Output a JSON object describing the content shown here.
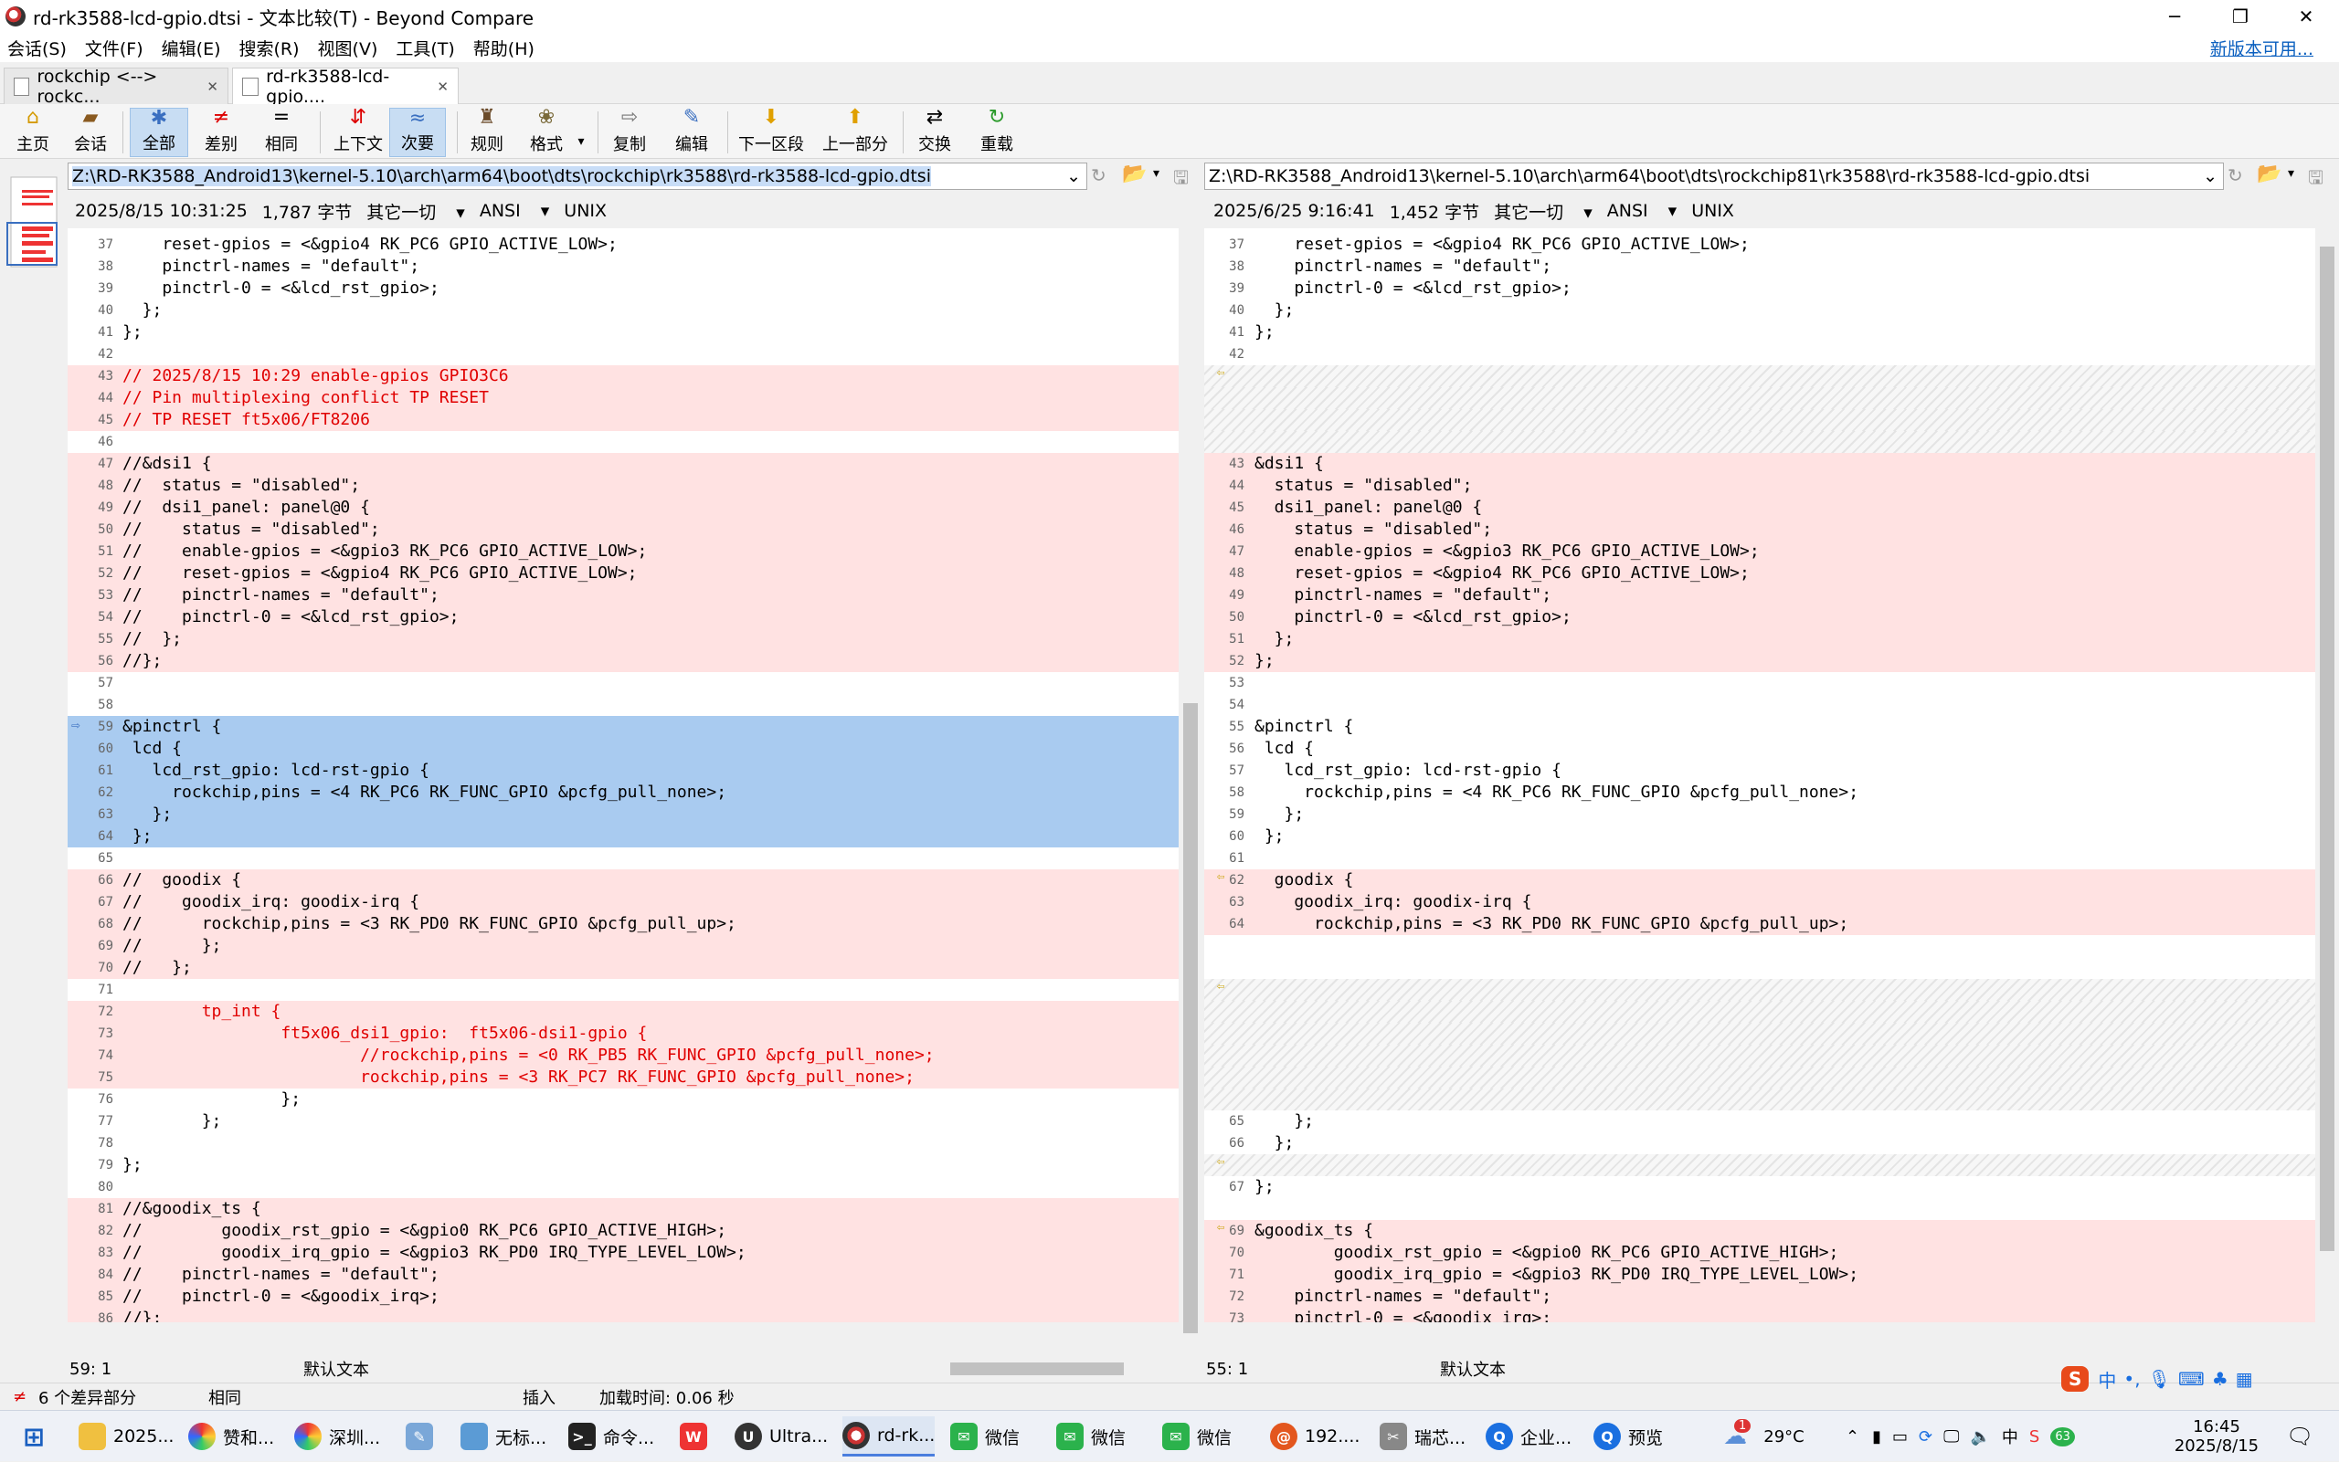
{
  "window": {
    "title": "rd-rk3588-lcd-gpio.dtsi - 文本比较(T) - Beyond Compare"
  },
  "menu": [
    "会话(S)",
    "文件(F)",
    "编辑(E)",
    "搜索(R)",
    "视图(V)",
    "工具(T)",
    "帮助(H)"
  ],
  "menu_newversion": "新版本可用...",
  "tabs": [
    {
      "label": "rockchip <--> rockc..."
    },
    {
      "label": "rd-rk3588-lcd-gpio...."
    }
  ],
  "toolbar": [
    "主页",
    "会话",
    "全部",
    "差别",
    "相同",
    "上下文",
    "次要",
    "规则",
    "格式",
    "复制",
    "编辑",
    "下一区段",
    "上一部分",
    "交换",
    "重载"
  ],
  "left": {
    "path": "Z:\\RD-RK3588_Android13\\kernel-5.10\\arch\\arm64\\boot\\dts\\rockchip\\rk3588\\rd-rk3588-lcd-gpio.dtsi",
    "date": "2025/8/15 10:31:25",
    "size": "1,787 字节",
    "other": "其它一切",
    "enc": "ANSI",
    "eol": "UNIX",
    "cursor": "59: 1",
    "mode": "默认文本",
    "lines": [
      {
        "n": "37",
        "t": "    reset-gpios = <&gpio4 RK_PC6 GPIO_ACTIVE_LOW>;",
        "c": "g"
      },
      {
        "n": "38",
        "t": "    pinctrl-names = \"default\";",
        "c": "g"
      },
      {
        "n": "39",
        "t": "    pinctrl-0 = <&lcd_rst_gpio>;",
        "c": "g"
      },
      {
        "n": "40",
        "t": "  };",
        "c": "g"
      },
      {
        "n": "41",
        "t": "};",
        "c": "g"
      },
      {
        "n": "42",
        "t": "",
        "c": "g"
      },
      {
        "n": "43",
        "t": "// 2025/8/15 10:29 enable-gpios GPIO3C6",
        "c": "d",
        "r": 1
      },
      {
        "n": "44",
        "t": "// Pin multiplexing conflict TP RESET",
        "c": "d",
        "r": 1
      },
      {
        "n": "45",
        "t": "// TP RESET ft5x06/FT8206",
        "c": "d",
        "r": 1
      },
      {
        "n": "46",
        "t": "",
        "c": "g"
      },
      {
        "n": "47",
        "t": "//&dsi1 {",
        "c": "d"
      },
      {
        "n": "48",
        "t": "//  status = \"disabled\";",
        "c": "d"
      },
      {
        "n": "49",
        "t": "//  dsi1_panel: panel@0 {",
        "c": "d"
      },
      {
        "n": "50",
        "t": "//    status = \"disabled\";",
        "c": "d"
      },
      {
        "n": "51",
        "t": "//    enable-gpios = <&gpio3 RK_PC6 GPIO_ACTIVE_LOW>;",
        "c": "d"
      },
      {
        "n": "52",
        "t": "//    reset-gpios = <&gpio4 RK_PC6 GPIO_ACTIVE_LOW>;",
        "c": "d"
      },
      {
        "n": "53",
        "t": "//    pinctrl-names = \"default\";",
        "c": "d"
      },
      {
        "n": "54",
        "t": "//    pinctrl-0 = <&lcd_rst_gpio>;",
        "c": "d"
      },
      {
        "n": "55",
        "t": "//  };",
        "c": "d"
      },
      {
        "n": "56",
        "t": "//};",
        "c": "d"
      },
      {
        "n": "57",
        "t": "",
        "c": "g"
      },
      {
        "n": "58",
        "t": "",
        "c": "g"
      },
      {
        "n": "59",
        "t": "&pinctrl {",
        "c": "s"
      },
      {
        "n": "60",
        "t": " lcd {",
        "c": "s"
      },
      {
        "n": "61",
        "t": "   lcd_rst_gpio: lcd-rst-gpio {",
        "c": "s"
      },
      {
        "n": "62",
        "t": "     rockchip,pins = <4 RK_PC6 RK_FUNC_GPIO &pcfg_pull_none>;",
        "c": "s"
      },
      {
        "n": "63",
        "t": "   };",
        "c": "s"
      },
      {
        "n": "64",
        "t": " };",
        "c": "s"
      },
      {
        "n": "65",
        "t": "",
        "c": "g"
      },
      {
        "n": "66",
        "t": "//  goodix {",
        "c": "d"
      },
      {
        "n": "67",
        "t": "//    goodix_irq: goodix-irq {",
        "c": "d"
      },
      {
        "n": "68",
        "t": "//      rockchip,pins = <3 RK_PD0 RK_FUNC_GPIO &pcfg_pull_up>;",
        "c": "d"
      },
      {
        "n": "69",
        "t": "//      };",
        "c": "d"
      },
      {
        "n": "70",
        "t": "//   };",
        "c": "d"
      },
      {
        "n": "71",
        "t": "",
        "c": "g"
      },
      {
        "n": "72",
        "t": "        tp_int {",
        "c": "d",
        "r": 1
      },
      {
        "n": "73",
        "t": "                ft5x06_dsi1_gpio:  ft5x06-dsi1-gpio {",
        "c": "d",
        "r": 1
      },
      {
        "n": "74",
        "t": "                        //rockchip,pins = <0 RK_PB5 RK_FUNC_GPIO &pcfg_pull_none>;",
        "c": "d",
        "r": 1
      },
      {
        "n": "75",
        "t": "                        rockchip,pins = <3 RK_PC7 RK_FUNC_GPIO &pcfg_pull_none>;",
        "c": "d",
        "r": 1
      },
      {
        "n": "76",
        "t": "                };",
        "c": "g"
      },
      {
        "n": "77",
        "t": "        };",
        "c": "g"
      },
      {
        "n": "78",
        "t": "",
        "c": "g"
      },
      {
        "n": "79",
        "t": "};",
        "c": "g"
      },
      {
        "n": "80",
        "t": "",
        "c": "g"
      },
      {
        "n": "81",
        "t": "//&goodix_ts {",
        "c": "d"
      },
      {
        "n": "82",
        "t": "//        goodix_rst_gpio = <&gpio0 RK_PC6 GPIO_ACTIVE_HIGH>;",
        "c": "d"
      },
      {
        "n": "83",
        "t": "//        goodix_irq_gpio = <&gpio3 RK_PD0 IRQ_TYPE_LEVEL_LOW>;",
        "c": "d"
      },
      {
        "n": "84",
        "t": "//    pinctrl-names = \"default\";",
        "c": "d"
      },
      {
        "n": "85",
        "t": "//    pinctrl-0 = <&goodix_irq>;",
        "c": "d"
      },
      {
        "n": "86",
        "t": "//};",
        "c": "d"
      }
    ]
  },
  "right": {
    "path": "Z:\\RD-RK3588_Android13\\kernel-5.10\\arch\\arm64\\boot\\dts\\rockchip81\\rk3588\\rd-rk3588-lcd-gpio.dtsi",
    "date": "2025/6/25 9:16:41",
    "size": "1,452 字节",
    "other": "其它一切",
    "enc": "ANSI",
    "eol": "UNIX",
    "cursor": "55: 1",
    "mode": "默认文本",
    "lines": [
      {
        "n": "37",
        "t": "    reset-gpios = <&gpio4 RK_PC6 GPIO_ACTIVE_LOW>;",
        "c": "g"
      },
      {
        "n": "38",
        "t": "    pinctrl-names = \"default\";",
        "c": "g"
      },
      {
        "n": "39",
        "t": "    pinctrl-0 = <&lcd_rst_gpio>;",
        "c": "g"
      },
      {
        "n": "40",
        "t": "  };",
        "c": "g"
      },
      {
        "n": "41",
        "t": "};",
        "c": "g"
      },
      {
        "n": "42",
        "t": "",
        "c": "g"
      },
      {
        "n": "",
        "t": "",
        "c": "h"
      },
      {
        "n": "",
        "t": "",
        "c": "h"
      },
      {
        "n": "",
        "t": "",
        "c": "h"
      },
      {
        "n": "",
        "t": "",
        "c": "h"
      },
      {
        "n": "43",
        "t": "&dsi1 {",
        "c": "d"
      },
      {
        "n": "44",
        "t": "  status = \"disabled\";",
        "c": "d"
      },
      {
        "n": "45",
        "t": "  dsi1_panel: panel@0 {",
        "c": "d"
      },
      {
        "n": "46",
        "t": "    status = \"disabled\";",
        "c": "d"
      },
      {
        "n": "47",
        "t": "    enable-gpios = <&gpio3 RK_PC6 GPIO_ACTIVE_LOW>;",
        "c": "d"
      },
      {
        "n": "48",
        "t": "    reset-gpios = <&gpio4 RK_PC6 GPIO_ACTIVE_LOW>;",
        "c": "d"
      },
      {
        "n": "49",
        "t": "    pinctrl-names = \"default\";",
        "c": "d"
      },
      {
        "n": "50",
        "t": "    pinctrl-0 = <&lcd_rst_gpio>;",
        "c": "d"
      },
      {
        "n": "51",
        "t": "  };",
        "c": "d"
      },
      {
        "n": "52",
        "t": "};",
        "c": "d"
      },
      {
        "n": "53",
        "t": "",
        "c": "g"
      },
      {
        "n": "54",
        "t": "",
        "c": "g"
      },
      {
        "n": "55",
        "t": "&pinctrl {",
        "c": "g"
      },
      {
        "n": "56",
        "t": " lcd {",
        "c": "g"
      },
      {
        "n": "57",
        "t": "   lcd_rst_gpio: lcd-rst-gpio {",
        "c": "g"
      },
      {
        "n": "58",
        "t": "     rockchip,pins = <4 RK_PC6 RK_FUNC_GPIO &pcfg_pull_none>;",
        "c": "g"
      },
      {
        "n": "59",
        "t": "   };",
        "c": "g"
      },
      {
        "n": "60",
        "t": " };",
        "c": "g"
      },
      {
        "n": "61",
        "t": "",
        "c": "g"
      },
      {
        "n": "62",
        "t": "  goodix {",
        "c": "d"
      },
      {
        "n": "63",
        "t": "    goodix_irq: goodix-irq {",
        "c": "d"
      },
      {
        "n": "64",
        "t": "      rockchip,pins = <3 RK_PD0 RK_FUNC_GPIO &pcfg_pull_up>;",
        "c": "d"
      },
      {
        "n": "",
        "t": "",
        "c": "g"
      },
      {
        "n": "",
        "t": "",
        "c": "g"
      },
      {
        "n": "",
        "t": "",
        "c": "h"
      },
      {
        "n": "",
        "t": "",
        "c": "h"
      },
      {
        "n": "",
        "t": "",
        "c": "h"
      },
      {
        "n": "",
        "t": "",
        "c": "h"
      },
      {
        "n": "",
        "t": "",
        "c": "h"
      },
      {
        "n": "",
        "t": "",
        "c": "h"
      },
      {
        "n": "65",
        "t": "    };",
        "c": "g"
      },
      {
        "n": "66",
        "t": "  };",
        "c": "g"
      },
      {
        "n": "",
        "t": "",
        "c": "h"
      },
      {
        "n": "67",
        "t": "};",
        "c": "g"
      },
      {
        "n": "",
        "t": "",
        "c": "g"
      },
      {
        "n": "69",
        "t": "&goodix_ts {",
        "c": "d"
      },
      {
        "n": "70",
        "t": "        goodix_rst_gpio = <&gpio0 RK_PC6 GPIO_ACTIVE_HIGH>;",
        "c": "d"
      },
      {
        "n": "71",
        "t": "        goodix_irq_gpio = <&gpio3 RK_PD0 IRQ_TYPE_LEVEL_LOW>;",
        "c": "d"
      },
      {
        "n": "72",
        "t": "    pinctrl-names = \"default\";",
        "c": "d"
      },
      {
        "n": "73",
        "t": "    pinctrl-0 = <&goodix_irq>;",
        "c": "d"
      },
      {
        "n": "74",
        "t": "};",
        "c": "d"
      }
    ]
  },
  "status": {
    "diffs": "6 个差异部分",
    "same": "相同",
    "insert": "插入",
    "loadtime": "加载时间: 0.06 秒"
  },
  "taskbar": {
    "items": [
      "2025...",
      "赞和...",
      "深圳...",
      "无标...",
      "命令...",
      "Ultra...",
      "rd-rk...",
      "微信",
      "微信",
      "微信",
      "192....",
      "瑞芯...",
      "企业...",
      "预览"
    ],
    "weather": "29°C",
    "badge": "1",
    "ime": "中",
    "time": "16:45",
    "date": "2025/8/15",
    "notif": "63"
  }
}
